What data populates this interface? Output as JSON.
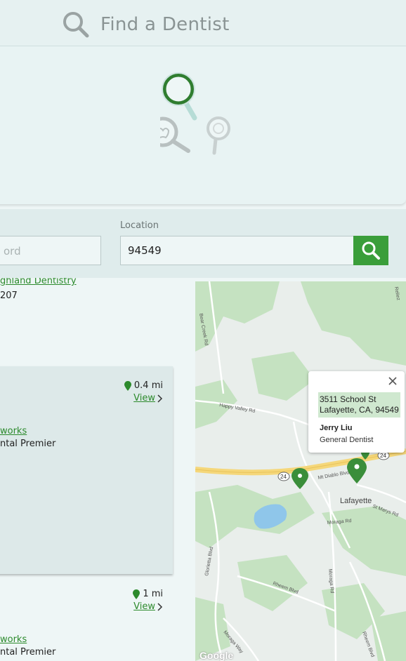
{
  "header": {
    "title": "Find a Dentist",
    "icon": "search-icon"
  },
  "hero": {
    "illustration": "magnifier-tooth-illustration"
  },
  "search": {
    "keyword_placeholder": "ord",
    "location_label": "Location",
    "location_value": "94549",
    "button_icon": "search-icon"
  },
  "results": {
    "first": {
      "name": "ghland Dentistry",
      "suite": "207"
    },
    "cards": [
      {
        "distance": "0.4 mi",
        "view_label": "View",
        "network": "works",
        "plan": "ntal Premier"
      },
      {
        "distance": "1 mi",
        "view_label": "View",
        "network": "works",
        "plan": "ntal Premier"
      }
    ]
  },
  "map": {
    "popup": {
      "address_line1": "3511 School St",
      "address_line2": "Lafayette, CA, 94549",
      "dentist_name": "Jerry Liu",
      "specialty": "General Dentist"
    },
    "labels": {
      "city": "Lafayette",
      "highway": "24",
      "road_mtdiablo": "Mt Diablo Blvd",
      "road_happyvalley": "Happy Valley Rd",
      "road_moraga": "Moraga Rd",
      "road_stmarys": "St Marys Rd",
      "road_rheem": "Rheem Blvd",
      "road_glorietta": "Glorietta Blvd",
      "road_moragaway": "Moraga Way",
      "road_bearcreek": "Bear Creek Rd",
      "road_reliez": "Reliez",
      "road_moraga2": "Moraga Rd",
      "road_rheem2": "Rheem Blvd"
    },
    "attribution": "Google",
    "colors": {
      "green_area": "#c8e3c4",
      "road": "#ffffff",
      "highway": "#f5d77a",
      "water": "#8fc6ea",
      "pin": "#3a9e3a"
    }
  },
  "colors": {
    "accent": "#3a9e3a",
    "background": "#eef6f6"
  }
}
